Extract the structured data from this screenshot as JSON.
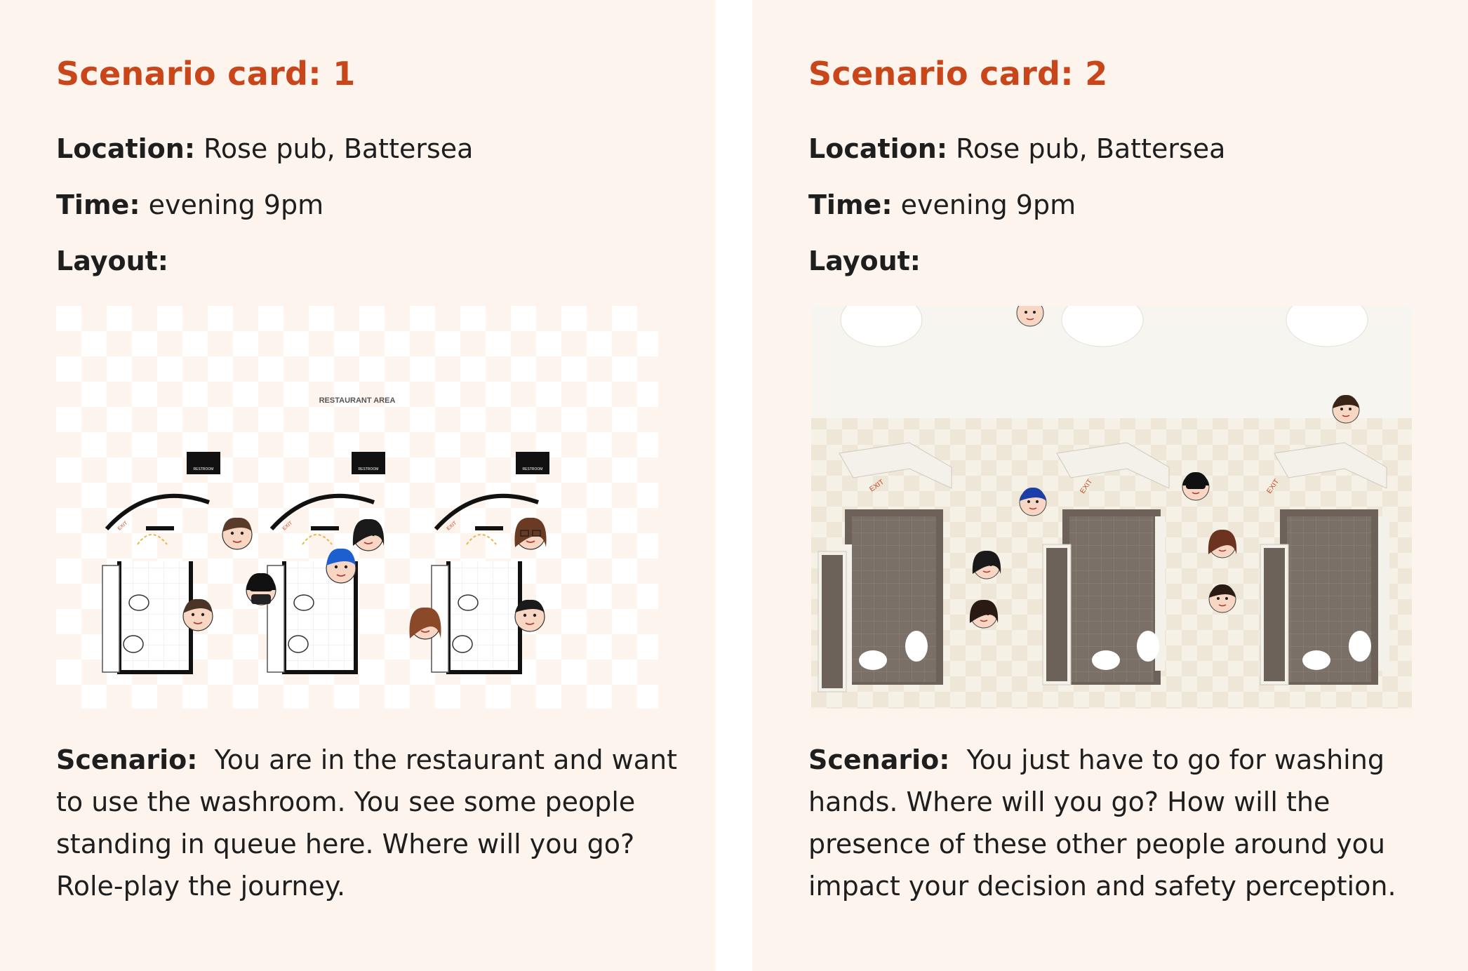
{
  "cards": [
    {
      "title": "Scenario card: 1",
      "location_label": "Location:",
      "location": "Rose pub, Battersea",
      "time_label": "Time:",
      "time": "evening 9pm",
      "layout_label": "Layout:",
      "scenario_label": "Scenario:",
      "scenario": "You are in the restaurant and want to use the washroom. You see some people standing in queue here. Where will you go? Role-play the journey.",
      "figure": {
        "area_label": "RESTAURANT AREA",
        "sign_label": "RESTROOM",
        "exit_label": "EXIT"
      }
    },
    {
      "title": "Scenario card: 2",
      "location_label": "Location:",
      "location": "Rose pub, Battersea",
      "time_label": "Time:",
      "time": "evening 9pm",
      "layout_label": "Layout:",
      "scenario_label": "Scenario:",
      "scenario": "You just have to go for washing hands. Where will you go? How will the presence of these other people around you impact your decision and safety perception.",
      "figure": {
        "exit_label": "EXIT"
      }
    }
  ],
  "colors": {
    "background": "#fdf4ee",
    "title": "#c8461a",
    "text": "#1e1e1e"
  }
}
